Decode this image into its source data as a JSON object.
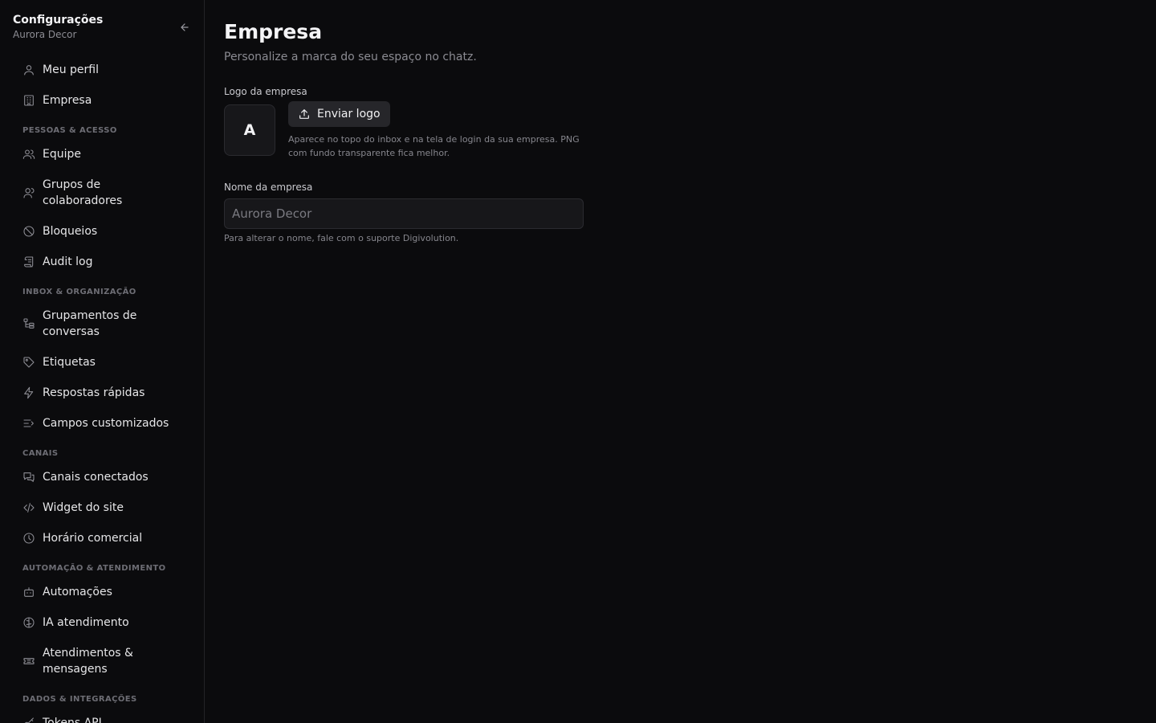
{
  "sidebar": {
    "title": "Configurações",
    "subtitle": "Aurora Decor",
    "top_items": [
      {
        "label": "Meu perfil",
        "icon": "user-icon"
      },
      {
        "label": "Empresa",
        "icon": "building-icon"
      }
    ],
    "sections": [
      {
        "title": "PESSOAS & ACESSO",
        "items": [
          {
            "label": "Equipe",
            "icon": "users-icon"
          },
          {
            "label": "Grupos de colaboradores",
            "icon": "user-group-icon"
          },
          {
            "label": "Bloqueios",
            "icon": "ban-icon"
          },
          {
            "label": "Audit log",
            "icon": "scroll-icon"
          }
        ]
      },
      {
        "title": "INBOX & ORGANIZAÇÃO",
        "items": [
          {
            "label": "Grupamentos de conversas",
            "icon": "tree-icon"
          },
          {
            "label": "Etiquetas",
            "icon": "tag-icon"
          },
          {
            "label": "Respostas rápidas",
            "icon": "zap-icon"
          },
          {
            "label": "Campos customizados",
            "icon": "fields-icon"
          }
        ]
      },
      {
        "title": "CANAIS",
        "items": [
          {
            "label": "Canais conectados",
            "icon": "messages-icon"
          },
          {
            "label": "Widget do site",
            "icon": "code-icon"
          },
          {
            "label": "Horário comercial",
            "icon": "clock-icon"
          }
        ]
      },
      {
        "title": "AUTOMAÇÃO & ATENDIMENTO",
        "items": [
          {
            "label": "Automações",
            "icon": "bot-icon"
          },
          {
            "label": "IA atendimento",
            "icon": "brain-icon"
          },
          {
            "label": "Atendimentos & mensagens",
            "icon": "ticket-icon"
          }
        ]
      },
      {
        "title": "DADOS & INTEGRAÇÕES",
        "items": [
          {
            "label": "Tokens API",
            "icon": "key-icon"
          }
        ]
      }
    ]
  },
  "main": {
    "title": "Empresa",
    "subtitle": "Personalize a marca do seu espaço no chatz.",
    "logo_label": "Logo da empresa",
    "logo_initial": "A",
    "upload_label": "Enviar logo",
    "logo_help": "Aparece no topo do inbox e na tela de login da sua empresa. PNG com fundo transparente fica melhor.",
    "name_label": "Nome da empresa",
    "name_value": "Aurora Decor",
    "name_help": "Para alterar o nome, fale com o suporte Digivolution."
  }
}
